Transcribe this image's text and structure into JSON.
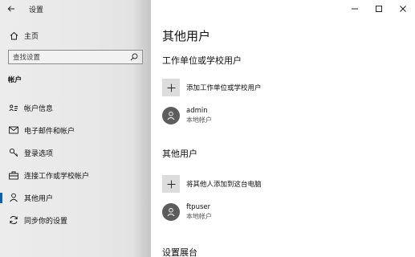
{
  "window": {
    "app_title": "设置",
    "controls": {
      "minimize": "—",
      "maximize": "☐",
      "close": "✕"
    }
  },
  "sidebar": {
    "back_icon": "back-arrow-icon",
    "home_label": "主页",
    "search_placeholder": "查找设置",
    "section_heading": "帐户",
    "items": [
      {
        "label": "帐户信息",
        "icon": "person-card-icon",
        "selected": false
      },
      {
        "label": "电子邮件和帐户",
        "icon": "mail-icon",
        "selected": false
      },
      {
        "label": "登录选项",
        "icon": "key-icon",
        "selected": false
      },
      {
        "label": "连接工作或学校帐户",
        "icon": "briefcase-icon",
        "selected": false
      },
      {
        "label": "其他用户",
        "icon": "person-icon",
        "selected": true
      },
      {
        "label": "同步你的设置",
        "icon": "sync-icon",
        "selected": false
      }
    ]
  },
  "main": {
    "page_title": "其他用户",
    "work_section": {
      "title": "工作单位或学校用户",
      "add_label": "添加工作单位或学校用户",
      "users": [
        {
          "name": "admin",
          "type": "本地帐户"
        }
      ]
    },
    "other_section": {
      "title": "其他用户",
      "add_label": "将其他人添加到这台电脑",
      "users": [
        {
          "name": "ftpuser",
          "type": "本地帐户"
        }
      ]
    },
    "kiosk_section": {
      "title": "设置展台"
    }
  },
  "colors": {
    "accent": "#0063b1",
    "avatar": "#5d5d5d",
    "add_tile": "#dcdcdc"
  }
}
